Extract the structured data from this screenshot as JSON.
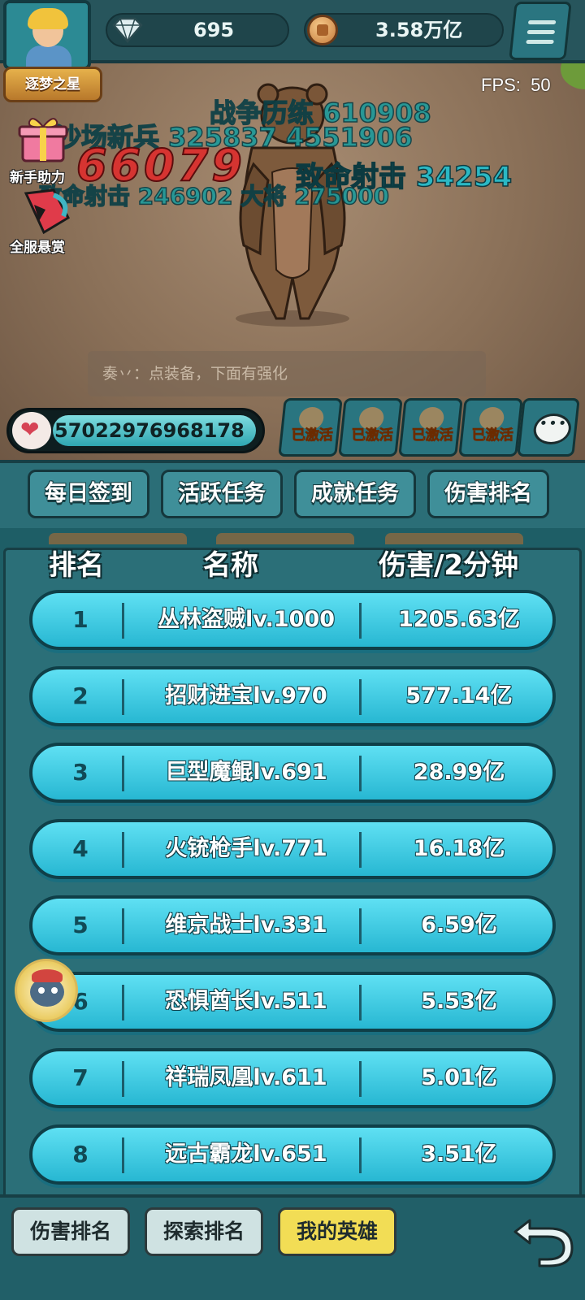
{
  "header": {
    "title_badge": "逐梦之星",
    "diamonds": "695",
    "coins": "3.58万亿",
    "fps_label": "FPS:",
    "fps_value": "50",
    "menu_icon": "hamburger-icon"
  },
  "battle": {
    "floating_damage": [
      {
        "text": "战争历练 610908",
        "color": "#1f9a9a"
      },
      {
        "text": "沙场新兵 325837 4551906",
        "color": "#1f9a9a"
      },
      {
        "text": "66079",
        "color": "#d63431"
      },
      {
        "text": "致命射击 34254",
        "color": "#2bb8c4"
      },
      {
        "text": "致命射击 246902 大将 275000",
        "color": "#1f9a9a"
      }
    ],
    "side_buttons": {
      "newbie_help": "新手助力",
      "server_bounty": "全服悬赏"
    },
    "chat_tip": "奏丷：点装备，下面有强化",
    "hp_value": "57022976968178",
    "buffs": [
      "已激活",
      "已激活",
      "已激活",
      "已激活"
    ]
  },
  "tabs": [
    "每日签到",
    "活跃任务",
    "成就任务",
    "伤害排名"
  ],
  "ranking": {
    "headers": {
      "rank": "排名",
      "name": "名称",
      "damage": "伤害/2分钟"
    },
    "rows": [
      {
        "rank": "1",
        "name": "丛林盗贼lv.1000",
        "damage": "1205.63亿"
      },
      {
        "rank": "2",
        "name": "招财进宝lv.970",
        "damage": "577.14亿"
      },
      {
        "rank": "3",
        "name": "巨型魔鲲lv.691",
        "damage": "28.99亿"
      },
      {
        "rank": "4",
        "name": "火铳枪手lv.771",
        "damage": "16.18亿"
      },
      {
        "rank": "5",
        "name": "维京战士lv.331",
        "damage": "6.59亿"
      },
      {
        "rank": "6",
        "name": "恐惧酋长lv.511",
        "damage": "5.53亿"
      },
      {
        "rank": "7",
        "name": "祥瑞凤凰lv.611",
        "damage": "5.01亿"
      },
      {
        "rank": "8",
        "name": "远古霸龙lv.651",
        "damage": "3.51亿"
      }
    ]
  },
  "bottom_nav": {
    "damage_rank": "伤害排名",
    "explore_rank": "探索排名",
    "my_heroes": "我的英雄",
    "active": "我的英雄"
  },
  "colors": {
    "panel_bg": "#2b6f78",
    "row_bg": "#3cc9e2",
    "active_tab": "#f2dd55",
    "buff_text": "#ffd23a"
  }
}
